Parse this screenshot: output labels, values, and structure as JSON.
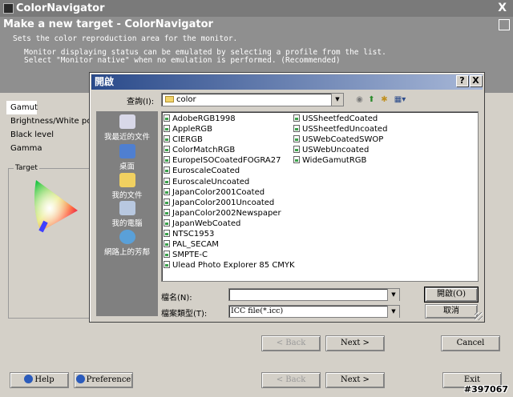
{
  "app": {
    "title": "ColorNavigator",
    "close_glyph": "X"
  },
  "header": {
    "heading": "Make a new target - ColorNavigator",
    "subtitle": "Sets the color reproduction area for the monitor.",
    "desc_line1": "Monitor displaying status can be emulated by selecting a profile from the list.",
    "desc_line2": "Select \"Monitor native\" when no emulation is performed. (Recommended)"
  },
  "sidebar": {
    "items": [
      {
        "label": "Gamut",
        "active": true
      },
      {
        "label": "Brightness/White pc",
        "active": false
      },
      {
        "label": "Black level",
        "active": false
      },
      {
        "label": "Gamma",
        "active": false
      }
    ]
  },
  "target": {
    "legend": "Target"
  },
  "wizard_buttons": {
    "back": "< Back",
    "next": "Next >",
    "cancel": "Cancel"
  },
  "footer": {
    "help": "Help",
    "preference": "Preference",
    "back": "< Back",
    "next": "Next >",
    "exit": "Exit"
  },
  "dialog": {
    "title": "開啟",
    "help_glyph": "?",
    "close_glyph": "X",
    "look_in_label": "查詢(I):",
    "look_in_value": "color",
    "places": [
      {
        "label": "我最近的文件",
        "icon": "recent-documents-icon"
      },
      {
        "label": "桌面",
        "icon": "desktop-icon"
      },
      {
        "label": "我的文件",
        "icon": "my-documents-icon"
      },
      {
        "label": "我的電腦",
        "icon": "my-computer-icon"
      },
      {
        "label": "網路上的芳鄰",
        "icon": "network-places-icon"
      }
    ],
    "files_col1": [
      "AdobeRGB1998",
      "AppleRGB",
      "CIERGB",
      "ColorMatchRGB",
      "EuropeISOCoatedFOGRA27",
      "EuroscaleCoated",
      "EuroscaleUncoated",
      "JapanColor2001Coated",
      "JapanColor2001Uncoated",
      "JapanColor2002Newspaper",
      "JapanWebCoated",
      "NTSC1953",
      "PAL_SECAM",
      "SMPTE-C",
      "Ulead Photo Explorer 85 CMYK"
    ],
    "files_col2": [
      "USSheetfedCoated",
      "USSheetfedUncoated",
      "USWebCoatedSWOP",
      "USWebUncoated",
      "WideGamutRGB"
    ],
    "file_name_label": "檔名(N):",
    "file_name_value": "",
    "file_type_label": "檔案類型(T):",
    "file_type_value": "ICC file(*.icc)",
    "open_button": "開啟(O)",
    "cancel_button": "取消"
  },
  "watermark": "#397067"
}
